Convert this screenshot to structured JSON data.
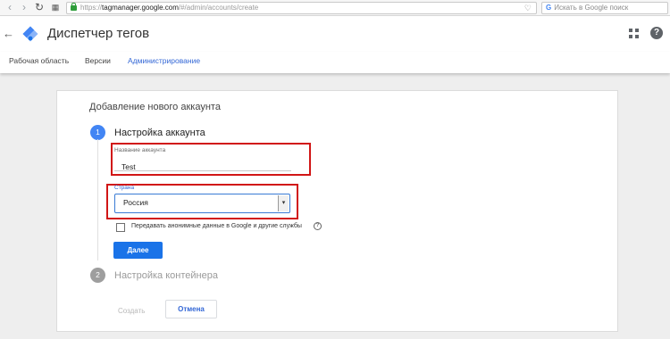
{
  "browser": {
    "url_prefix": "https://",
    "url_domain": "tagmanager.google.com",
    "url_path": "/#/admin/accounts/create",
    "search_placeholder": "Искать в Google поиск"
  },
  "app": {
    "title": "Диспетчер тегов"
  },
  "tabs": [
    {
      "label": "Рабочая область"
    },
    {
      "label": "Версии"
    },
    {
      "label": "Администрирование",
      "active": true
    }
  ],
  "form": {
    "title": "Добавление нового аккаунта",
    "step1": {
      "number": "1",
      "title": "Настройка аккаунта",
      "account_name_label": "Название аккаунта",
      "account_name_value": "Test",
      "country_label": "Страна",
      "country_value": "Россия",
      "share_label": "Передавать анонимные данные в Google и другие службы",
      "share_checked": false,
      "next_label": "Далее"
    },
    "step2": {
      "number": "2",
      "title": "Настройка контейнера"
    },
    "create_label": "Создать",
    "cancel_label": "Отмена"
  },
  "colors": {
    "primary": "#1a73e8",
    "highlight": "#d11616"
  }
}
